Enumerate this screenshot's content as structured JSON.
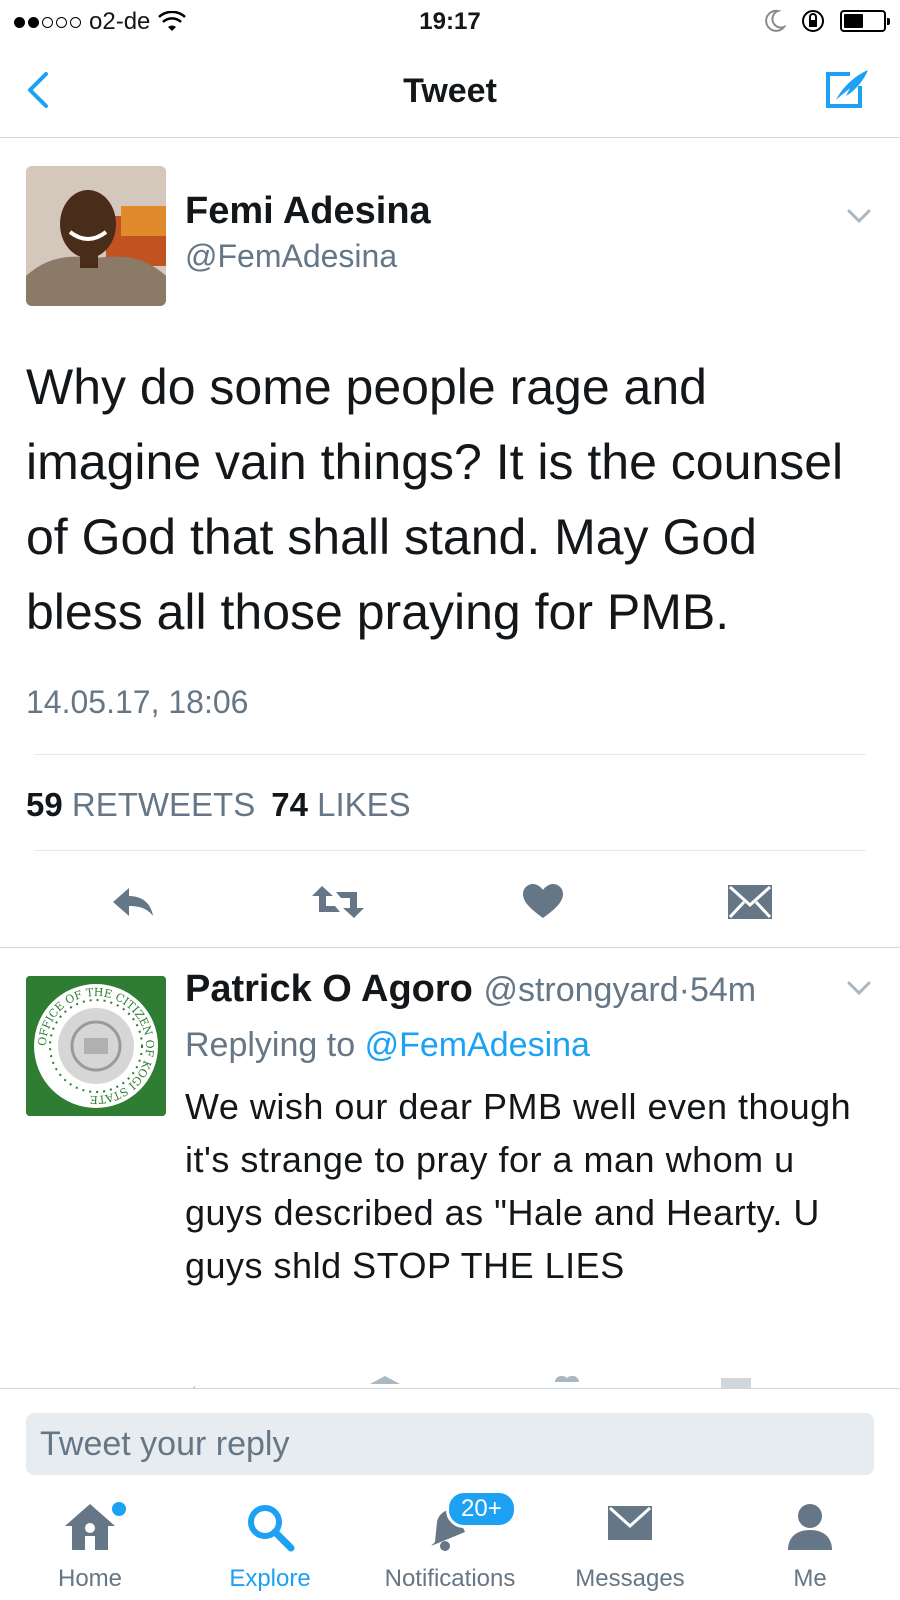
{
  "status_bar": {
    "carrier": "o2-de",
    "time": "19:17",
    "battery_level": 0.5
  },
  "nav": {
    "title": "Tweet"
  },
  "main_tweet": {
    "author_name": "Femi Adesina",
    "author_handle": "@FemAdesina",
    "text": "Why do some people rage and imagine vain things? It is the counsel of God that shall stand. May God bless all those praying for PMB.",
    "timestamp": "14.05.17, 18:06",
    "retweets_count": "59",
    "retweets_label": "RETWEETS",
    "likes_count": "74",
    "likes_label": "LIKES"
  },
  "reply_tweet": {
    "author_name": "Patrick O Agoro",
    "author_handle": "@strongyard",
    "separator": "·",
    "time_ago": "54m",
    "replying_prefix": "Replying to",
    "replying_to": "@FemAdesina",
    "text": "We wish our dear PMB well even though it's strange to pray for a man whom u guys described as \"Hale and Hearty. U guys shld STOP THE LIES",
    "avatar_seal_text": "OFFICE OF THE CITIZEN OF KOGI STATE"
  },
  "reply_box": {
    "placeholder": "Tweet your reply"
  },
  "tab_bar": {
    "tabs": [
      {
        "label": "Home",
        "icon": "home-icon",
        "has_dot": true
      },
      {
        "label": "Explore",
        "icon": "search-icon",
        "active": true
      },
      {
        "label": "Notifications",
        "icon": "bell-icon",
        "badge": "20+"
      },
      {
        "label": "Messages",
        "icon": "envelope-icon"
      },
      {
        "label": "Me",
        "icon": "person-icon"
      }
    ]
  },
  "colors": {
    "accent": "#1da1f2",
    "icon_gray": "#657786",
    "text": "#14171a"
  }
}
